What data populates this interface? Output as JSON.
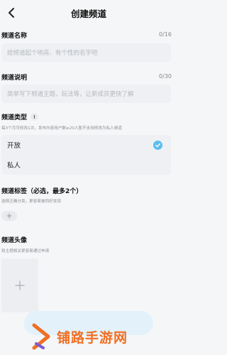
{
  "header": {
    "title": "创建频道",
    "back_icon": "back-chevron-icon"
  },
  "name_section": {
    "label": "频道名称",
    "counter": "0/16",
    "placeholder": "给频道起个响亮、有个性的名字吧"
  },
  "desc_section": {
    "label": "频道说明",
    "counter": "0/30",
    "placeholder": "简单写下频道主题、玩法等，让新成员更快了解"
  },
  "type_section": {
    "label": "频道类型",
    "info_icon": "exclamation-info-icon",
    "info_glyph": "!",
    "hint": "每3个月可修改1次，发布内容用户数≥20人暂不支持修改为私人频道",
    "options": [
      {
        "label": "开放",
        "selected": true
      },
      {
        "label": "私人",
        "selected": false
      }
    ],
    "accent_color": "#5dbdf2"
  },
  "tag_section": {
    "label": "频道标签（必选，最多2个）",
    "hint": "选择正确分类，更容易被同好发现",
    "add_icon": "plus-icon"
  },
  "avatar_section": {
    "label": "频道头像",
    "hint": "和主题相关更容易通过申请",
    "add_icon": "plus-icon"
  },
  "watermark": {
    "text": "铺路手游网",
    "color": "#ef6f23"
  }
}
